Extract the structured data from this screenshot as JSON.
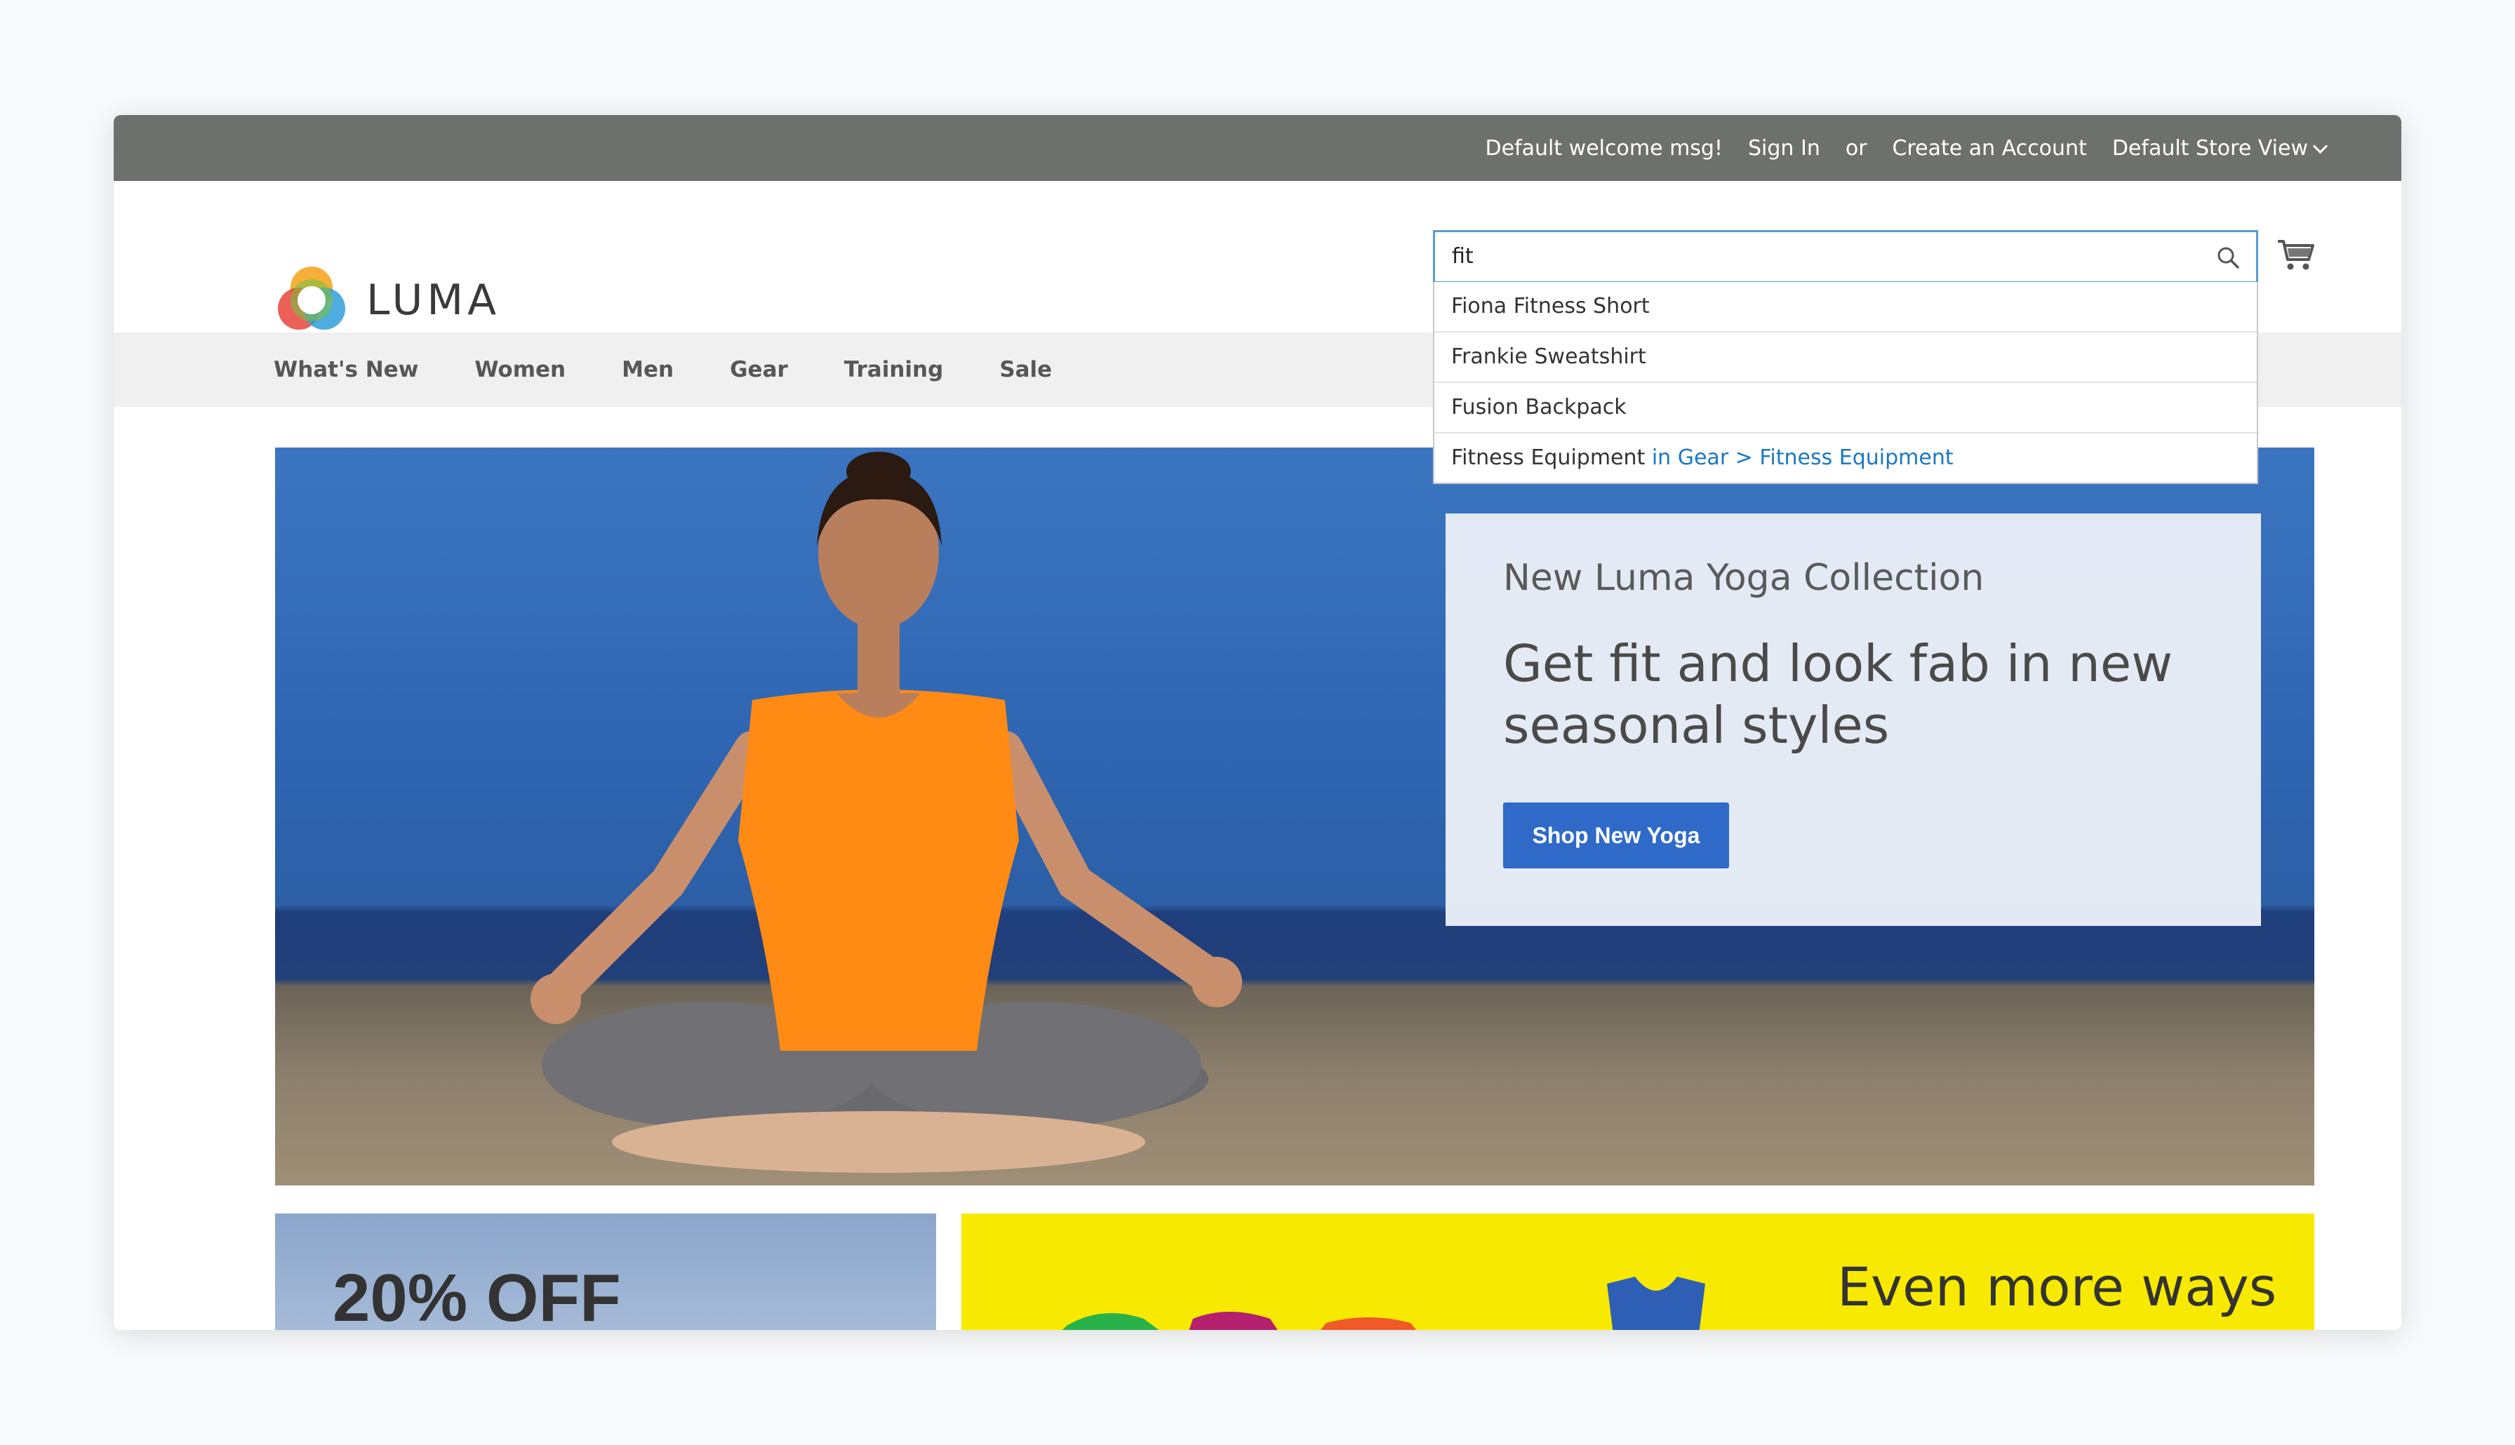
{
  "top_panel": {
    "welcome": "Default welcome msg!",
    "sign_in": "Sign In",
    "or": "or",
    "create_account": "Create an Account",
    "store_view": "Default Store View"
  },
  "header": {
    "logo_text": "LUMA",
    "search": {
      "value": "fit",
      "placeholder": ""
    }
  },
  "autocomplete": {
    "items": [
      {
        "label": "Fiona Fitness Short"
      },
      {
        "label": "Frankie Sweatshirt"
      },
      {
        "label": "Fusion Backpack"
      },
      {
        "label": "Fitness Equipment",
        "category": "in Gear > Fitness Equipment"
      }
    ]
  },
  "nav": {
    "items": [
      "What's New",
      "Women",
      "Men",
      "Gear",
      "Training",
      "Sale"
    ]
  },
  "hero": {
    "subtitle": "New Luma Yoga Collection",
    "title": "Get fit and look fab in new seasonal styles",
    "button": "Shop New Yoga"
  },
  "tiles": {
    "left_text": "20% OFF",
    "right_text": "Even more ways"
  },
  "colors": {
    "top_bar": "#6e706e",
    "accent": "#2f6ac9",
    "link": "#1979c3"
  },
  "icons": [
    "search-icon",
    "cart-icon",
    "chevron-down-icon"
  ]
}
